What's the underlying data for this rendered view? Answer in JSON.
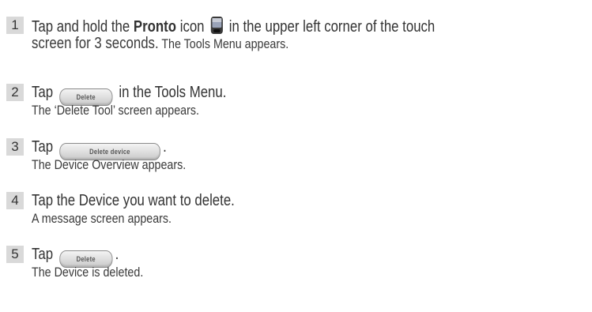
{
  "steps": [
    {
      "number": "1",
      "line1": {
        "text_a": "Tap and hold the ",
        "bold": "Pronto",
        "text_b": " icon ",
        "icon": "pronto-device-icon",
        "text_c": " in the upper left corner of the touch"
      },
      "line2": {
        "strong": "screen for 3 seconds.",
        "normal": " The Tools Menu appears."
      }
    },
    {
      "number": "2",
      "line1": {
        "text_a": "Tap ",
        "button_label": "Delete",
        "text_b": " in the Tools Menu."
      },
      "line2": "The ‘Delete Tool’ screen appears."
    },
    {
      "number": "3",
      "line1": {
        "text_a": "Tap ",
        "button_label": "Delete device",
        "text_b": "."
      },
      "line2": "The Device Overview appears."
    },
    {
      "number": "4",
      "line1": "Tap the Device you want to delete.",
      "line2": "A message screen appears."
    },
    {
      "number": "5",
      "line1": {
        "text_a": "Tap ",
        "button_label": "Delete",
        "text_b": "."
      },
      "line2": "The Device is deleted."
    }
  ],
  "colors": {
    "badge_bg": "#d9d9d9",
    "text": "#333333"
  }
}
